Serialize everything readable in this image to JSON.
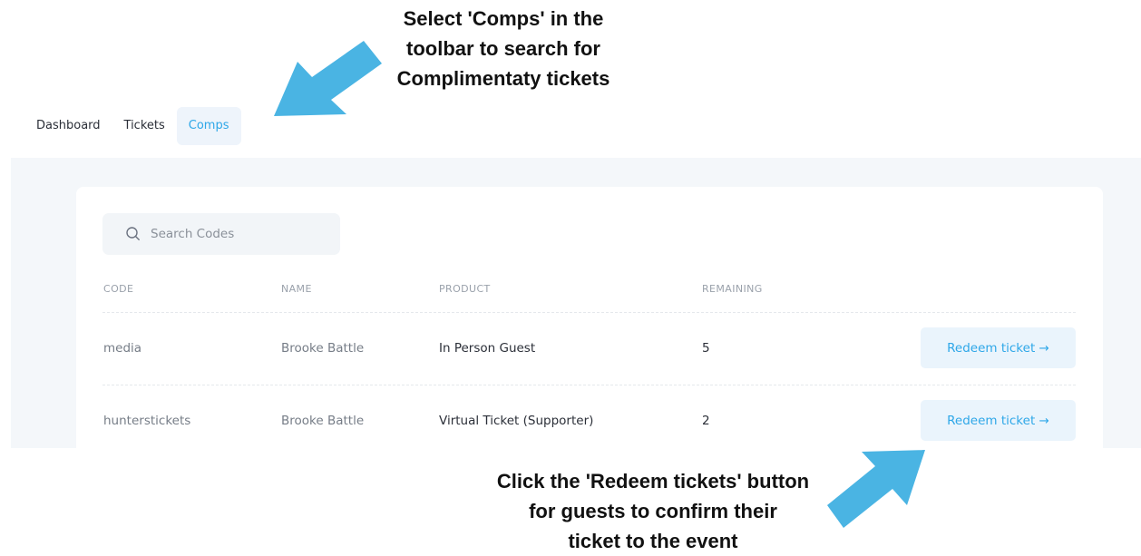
{
  "callouts": {
    "top": [
      "Select 'Comps' in the",
      "toolbar to search for",
      "Complimentaty tickets"
    ],
    "bottom": [
      "Click the 'Redeem tickets' button",
      "for guests to confirm their",
      "ticket to the event"
    ],
    "arrow_color": "#4ab4e3"
  },
  "nav": {
    "tabs": [
      {
        "label": "Dashboard",
        "active": false
      },
      {
        "label": "Tickets",
        "active": false
      },
      {
        "label": "Comps",
        "active": true
      }
    ]
  },
  "search": {
    "placeholder": "Search Codes",
    "value": "",
    "icon": "search-icon"
  },
  "table": {
    "headers": {
      "code": "CODE",
      "name": "NAME",
      "product": "PRODUCT",
      "remaining": "REMAINING"
    },
    "rows": [
      {
        "code": "media",
        "name": "Brooke Battle",
        "product": "In Person Guest",
        "remaining": "5",
        "action": "Redeem ticket →"
      },
      {
        "code": "hunterstickets",
        "name": "Brooke Battle",
        "product": "Virtual Ticket (Supporter)",
        "remaining": "2",
        "action": "Redeem ticket →"
      }
    ]
  },
  "colors": {
    "accent": "#2ea7e8",
    "stage_bg": "#f4f7fa",
    "button_bg": "#eaf4fc",
    "active_tab_bg": "#eef4fb"
  }
}
